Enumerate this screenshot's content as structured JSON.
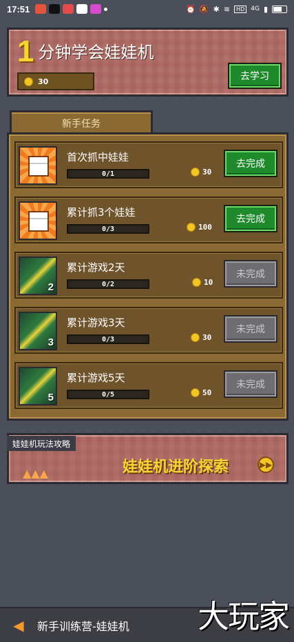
{
  "status_bar": {
    "time": "17:51",
    "network": "HD",
    "signal": "4G"
  },
  "learn_banner": {
    "number": "1",
    "title": "分钟学会娃娃机",
    "coins": "30",
    "button": "去学习"
  },
  "tasks_tab": "新手任务",
  "tasks": [
    {
      "title": "首次抓中娃娃",
      "progress": "0/1",
      "reward": "30",
      "button": "去完成",
      "status": "active",
      "icon": "fist-icon",
      "days": ""
    },
    {
      "title": "累计抓3个娃娃",
      "progress": "0/3",
      "reward": "100",
      "button": "去完成",
      "status": "active",
      "icon": "fist-icon",
      "days": ""
    },
    {
      "title": "累计游戏2天",
      "progress": "0/2",
      "reward": "10",
      "button": "未完成",
      "status": "inactive",
      "icon": "road-icon",
      "days": "2"
    },
    {
      "title": "累计游戏3天",
      "progress": "0/3",
      "reward": "30",
      "button": "未完成",
      "status": "inactive",
      "icon": "road-icon",
      "days": "3"
    },
    {
      "title": "累计游戏5天",
      "progress": "0/5",
      "reward": "50",
      "button": "未完成",
      "status": "inactive",
      "icon": "road-icon",
      "days": "5"
    }
  ],
  "guide": {
    "label": "娃娃机玩法攻略",
    "banner_text": "娃娃机进阶探索"
  },
  "bottom_bar": {
    "title": "新手训练营-娃娃机"
  },
  "watermark": "大玩家",
  "colors": {
    "background": "#4a4f5a",
    "accent_yellow": "#f6d531",
    "button_green": "#1f8a2c",
    "button_gray": "#6d6d72",
    "panel_brown": "#8a6a32"
  }
}
